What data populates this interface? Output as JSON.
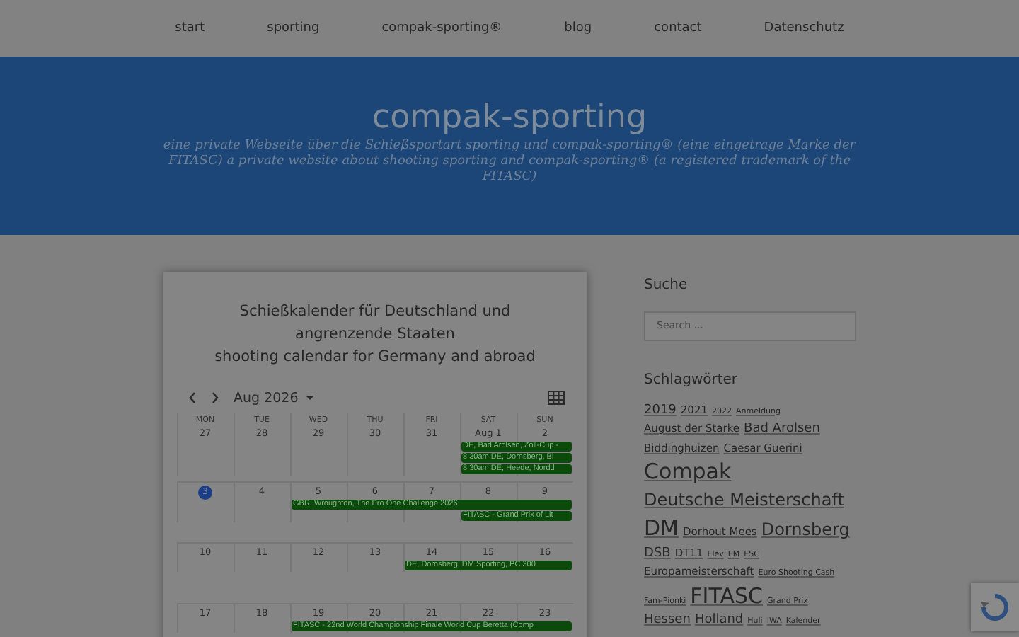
{
  "nav": [
    {
      "label": "start"
    },
    {
      "label": "sporting"
    },
    {
      "label": "compak-sporting®"
    },
    {
      "label": "blog"
    },
    {
      "label": "contact"
    },
    {
      "label": "Datenschutz"
    }
  ],
  "header": {
    "title": "compak-sporting",
    "tagline": "eine private Webseite über die Schießsportart sporting und compak-sporting® (eine eingetrage Marke der FITASC) a private website about shooting sporting and compak-sporting® (a registered trademark of the FITASC)"
  },
  "calendar_card": {
    "title": "Schießkalender für Deutschland und angrenzende Staaten",
    "subtitle": "shooting calendar for Germany and abroad",
    "month": "Aug 2026",
    "weekdays": [
      "MON",
      "TUE",
      "WED",
      "THU",
      "FRI",
      "SAT",
      "SUN"
    ],
    "weeks": [
      {
        "days": [
          {
            "label": "27",
            "today": false
          },
          {
            "label": "28",
            "today": false
          },
          {
            "label": "29",
            "today": false
          },
          {
            "label": "30",
            "today": false
          },
          {
            "label": "31",
            "today": false
          },
          {
            "label": "Aug 1",
            "today": false
          },
          {
            "label": "2",
            "today": false
          }
        ],
        "lanes": [
          [
            {
              "kind": "empty"
            },
            {
              "kind": "empty"
            },
            {
              "kind": "empty"
            },
            {
              "kind": "empty"
            },
            {
              "kind": "empty"
            },
            {
              "kind": "start",
              "text": "DE, Bad Arolsen, Zoll-Cup -"
            },
            {
              "kind": "cont"
            }
          ],
          [
            {
              "kind": "empty"
            },
            {
              "kind": "empty"
            },
            {
              "kind": "empty"
            },
            {
              "kind": "empty"
            },
            {
              "kind": "empty"
            },
            {
              "kind": "start",
              "text": "8:30am DE, Dornsberg, Bl"
            },
            {
              "kind": "cont"
            }
          ],
          [
            {
              "kind": "empty"
            },
            {
              "kind": "empty"
            },
            {
              "kind": "empty"
            },
            {
              "kind": "empty"
            },
            {
              "kind": "empty"
            },
            {
              "kind": "start",
              "text": "8:30am DE, Heede, Nordd"
            },
            {
              "kind": "cont"
            }
          ]
        ]
      },
      {
        "days": [
          {
            "label": "3",
            "today": true
          },
          {
            "label": "4",
            "today": false
          },
          {
            "label": "5",
            "today": false
          },
          {
            "label": "6",
            "today": false
          },
          {
            "label": "7",
            "today": false
          },
          {
            "label": "8",
            "today": false
          },
          {
            "label": "9",
            "today": false
          }
        ],
        "lanes": [
          [
            {
              "kind": "empty"
            },
            {
              "kind": "empty"
            },
            {
              "kind": "start",
              "text": "GBR, Wroughton, The Pro One Challenge 2026"
            },
            {
              "kind": "cont"
            },
            {
              "kind": "cont"
            },
            {
              "kind": "cont"
            },
            {
              "kind": "cont"
            }
          ],
          [
            {
              "kind": "empty"
            },
            {
              "kind": "empty"
            },
            {
              "kind": "empty"
            },
            {
              "kind": "empty"
            },
            {
              "kind": "empty"
            },
            {
              "kind": "start",
              "text": "FITASC - Grand Prix of Lit"
            },
            {
              "kind": "cont"
            }
          ]
        ]
      },
      {
        "days": [
          {
            "label": "10",
            "today": false
          },
          {
            "label": "11",
            "today": false
          },
          {
            "label": "12",
            "today": false
          },
          {
            "label": "13",
            "today": false
          },
          {
            "label": "14",
            "today": false
          },
          {
            "label": "15",
            "today": false
          },
          {
            "label": "16",
            "today": false
          }
        ],
        "lanes": [
          [
            {
              "kind": "empty"
            },
            {
              "kind": "empty"
            },
            {
              "kind": "empty"
            },
            {
              "kind": "empty"
            },
            {
              "kind": "start",
              "text": "DE, Dornsberg, DM Sporting, PC 300"
            },
            {
              "kind": "cont"
            },
            {
              "kind": "cont"
            }
          ]
        ]
      },
      {
        "days": [
          {
            "label": "17",
            "today": false
          },
          {
            "label": "18",
            "today": false
          },
          {
            "label": "19",
            "today": false
          },
          {
            "label": "20",
            "today": false
          },
          {
            "label": "21",
            "today": false
          },
          {
            "label": "22",
            "today": false
          },
          {
            "label": "23",
            "today": false
          }
        ],
        "lanes": [
          [
            {
              "kind": "empty"
            },
            {
              "kind": "empty"
            },
            {
              "kind": "start",
              "text": "FITASC - 22nd World Championship Finale World Cup Beretta (Comp"
            },
            {
              "kind": "cont"
            },
            {
              "kind": "cont"
            },
            {
              "kind": "cont"
            },
            {
              "kind": "cont"
            }
          ]
        ]
      }
    ]
  },
  "sidebar": {
    "search_heading": "Suche",
    "search": {
      "placeholder": "Search ..."
    },
    "tags_heading": "Schlagwörter",
    "tags": [
      {
        "text": "2019",
        "kind": "m"
      },
      {
        "text": "2021",
        "kind": "s"
      },
      {
        "text": "2022",
        "kind": "xs"
      },
      {
        "text": "Anmeldung",
        "kind": "xs"
      },
      {
        "text": "August der Starke",
        "kind": "s"
      },
      {
        "text": "Bad Arolsen",
        "kind": "m"
      },
      {
        "text": "Biddinghuizen",
        "kind": "s"
      },
      {
        "text": "Caesar Guerini",
        "kind": "s"
      },
      {
        "text": "Compak",
        "kind": "xl"
      },
      {
        "text": "Deutsche Meisterschaft",
        "kind": "l"
      },
      {
        "text": "DM",
        "kind": "xl"
      },
      {
        "text": "Dorhout Mees",
        "kind": "s"
      },
      {
        "text": "Dornsberg",
        "kind": "l"
      },
      {
        "text": "DSB",
        "kind": "m"
      },
      {
        "text": "DT11",
        "kind": "s"
      },
      {
        "text": "Elev",
        "kind": "xs"
      },
      {
        "text": "EM",
        "kind": "xs"
      },
      {
        "text": "ESC",
        "kind": "xs"
      },
      {
        "text": "Europameisterschaft",
        "kind": "s"
      },
      {
        "text": "Euro Shooting Cash",
        "kind": "xs"
      },
      {
        "text": "Fam-Pionki",
        "kind": "xs"
      },
      {
        "text": "FITASC",
        "kind": "xl"
      },
      {
        "text": "Grand Prix",
        "kind": "xs"
      },
      {
        "text": "Hessen",
        "kind": "m"
      },
      {
        "text": "Holland",
        "kind": "m"
      },
      {
        "text": "Huli",
        "kind": "xs"
      },
      {
        "text": "IWA",
        "kind": "xs"
      },
      {
        "text": "Kalender",
        "kind": "xs"
      }
    ]
  }
}
